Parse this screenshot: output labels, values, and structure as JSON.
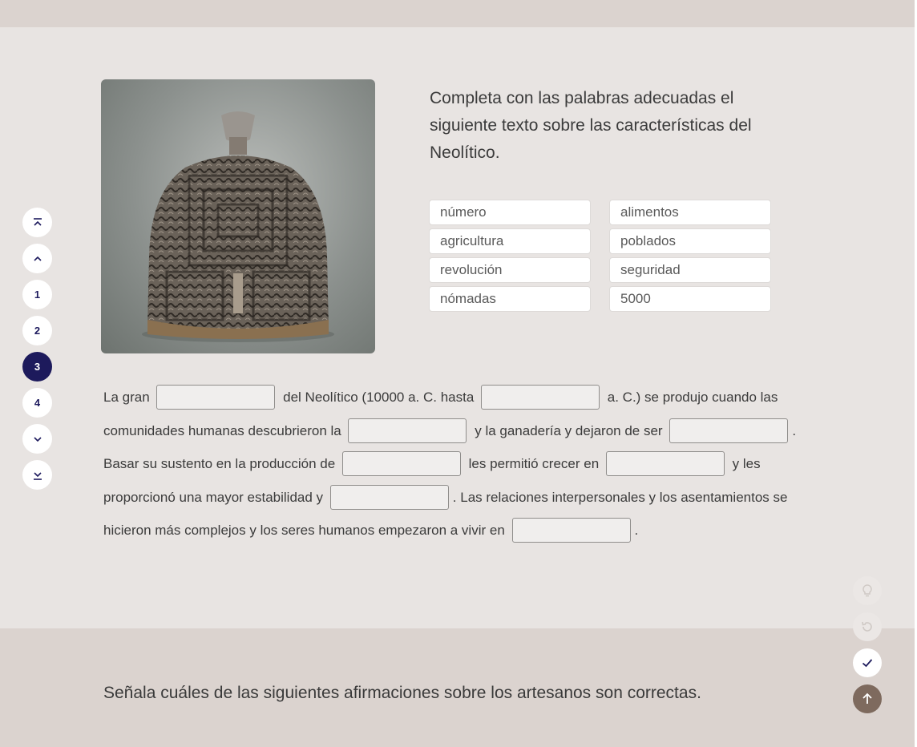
{
  "activity": {
    "instructions": "Completa con las palabras adecuadas el siguiente texto sobre las características del Neolítico.",
    "word_bank": [
      "número",
      "alimentos",
      "agricultura",
      "poblados",
      "revolución",
      "seguridad",
      "nómadas",
      "5000"
    ],
    "text": {
      "s1": "La gran",
      "s2": "del Neolítico (10000 a. C. hasta",
      "s3": "a. C.) se produjo cuando las comunidades humanas descubrieron la",
      "s4": "y la ganadería y dejaron de ser",
      "s5": ". Basar su sustento en la producción de",
      "s6": "les permitió crecer en",
      "s7": "y les proporcionó una mayor estabilidad y",
      "s8": ". Las relaciones interpersonales y los asentamientos se hicieron más complejos y los seres humanos empezaron a vivir en",
      "s9": "."
    }
  },
  "nav": {
    "pages": [
      "1",
      "2",
      "3",
      "4"
    ],
    "current_page": "3",
    "icons": [
      "chevron-double-up-icon",
      "chevron-up-icon",
      "chevron-down-icon",
      "chevron-double-down-icon"
    ]
  },
  "actions": {
    "icons": [
      "lightbulb-icon",
      "reset-icon",
      "check-icon",
      "arrow-up-icon"
    ]
  },
  "next_activity": {
    "instructions": "Señala cuáles de las siguientes afirmaciones sobre los artesanos son correctas."
  },
  "colors": {
    "accent": "#1d1a5c",
    "brown": "#7e6a5e",
    "card_bg": "#e8e4e2",
    "page_bg": "#dbd3cf"
  }
}
